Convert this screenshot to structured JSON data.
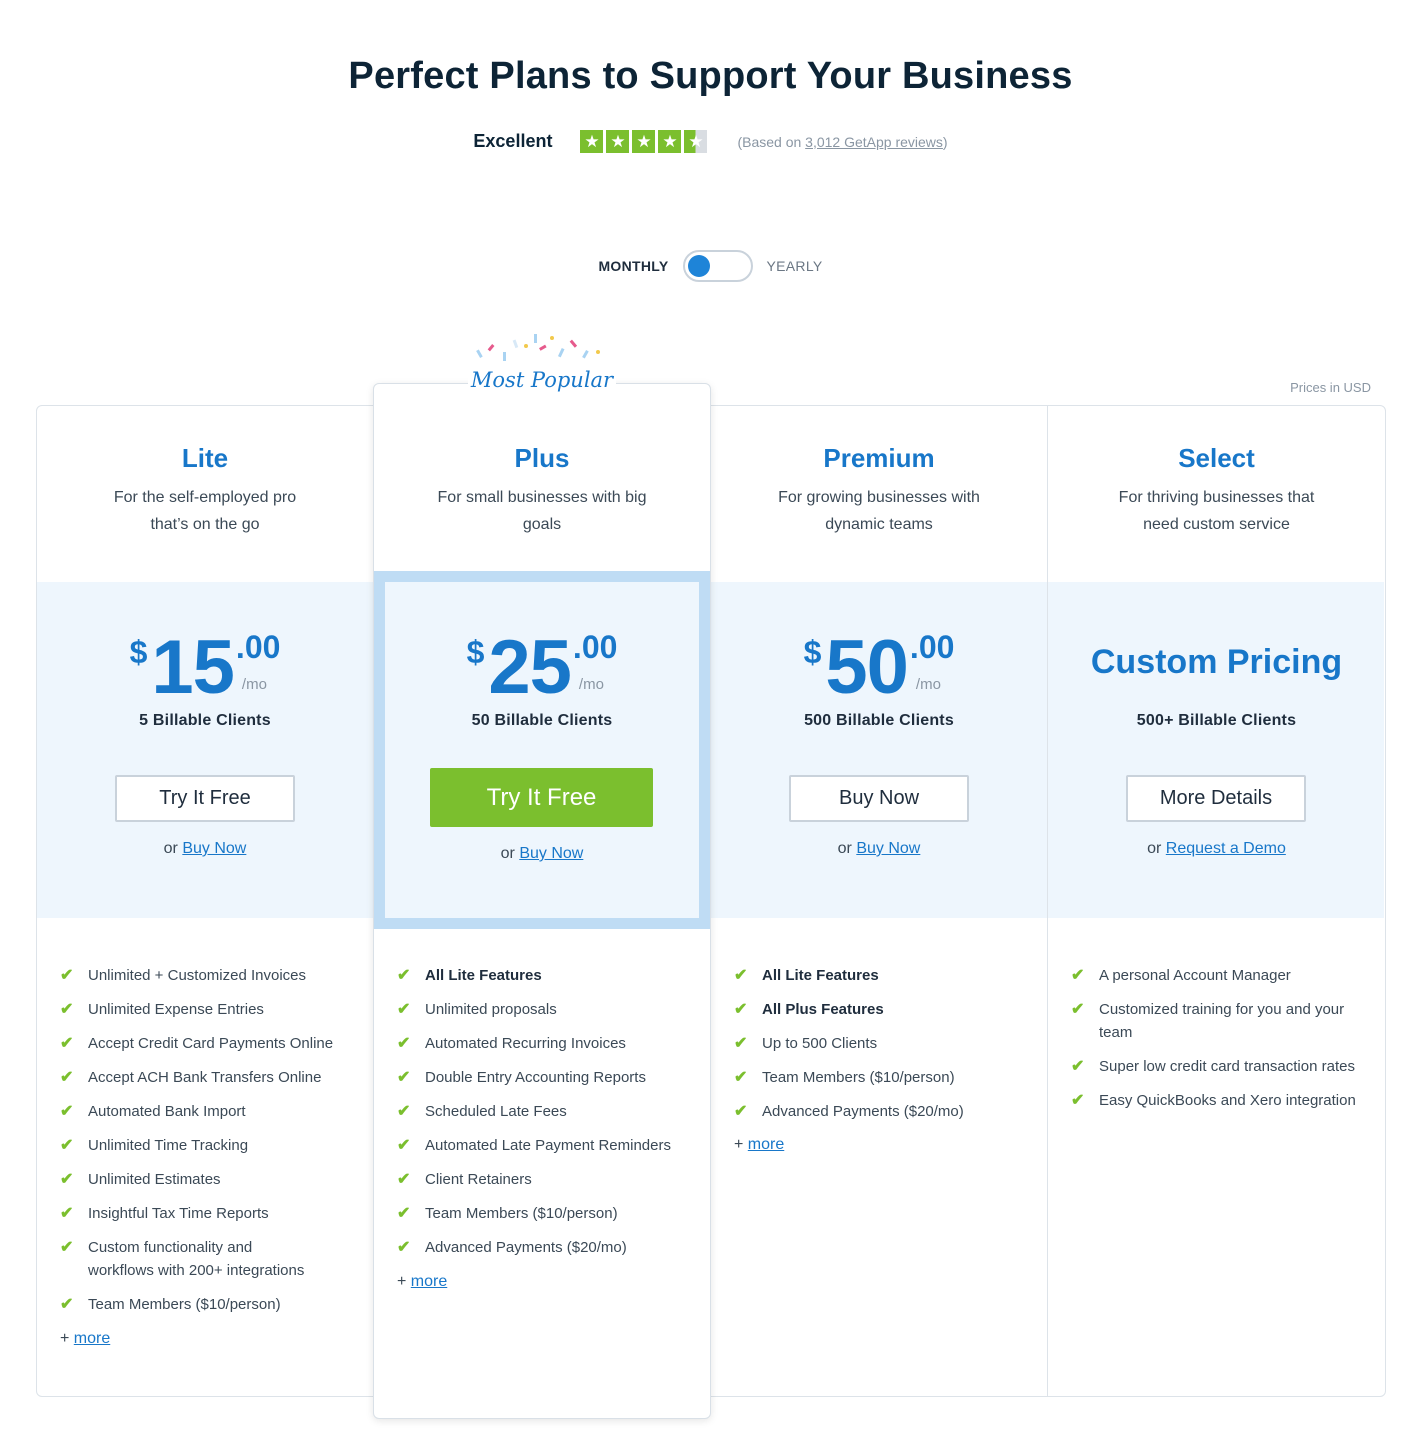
{
  "header": {
    "title": "Perfect Plans to Support Your Business",
    "rating_label": "Excellent",
    "stars": 4.5,
    "reviews_prefix": "(Based on ",
    "reviews_link": "3,012 GetApp reviews",
    "reviews_suffix": ")"
  },
  "billing_toggle": {
    "left_label": "MONTHLY",
    "right_label": "YEARLY",
    "selected": "MONTHLY"
  },
  "prices_note": "Prices in USD",
  "badge": "Most Popular",
  "colors": {
    "brand_blue": "#1877c9",
    "green": "#7bbf2e",
    "band": "#eef6fd"
  },
  "plans": [
    {
      "name": "Lite",
      "desc_line1": "For the self-employed pro",
      "desc_line2": "that’s on the go",
      "currency": "$",
      "amount": "15",
      "cents": ".00",
      "period": "/mo",
      "clients": "5 Billable Clients",
      "button": "Try It Free",
      "alt_prefix": "or ",
      "alt_link": "Buy Now",
      "features": [
        "Unlimited + Customized Invoices",
        "Unlimited Expense Entries",
        "Accept Credit Card Payments Online",
        "Accept ACH Bank Transfers Online",
        "Automated Bank Import",
        "Unlimited Time Tracking",
        "Unlimited Estimates",
        "Insightful Tax Time Reports",
        "Custom functionality and workflows with 200+ integrations",
        "Team Members ($10/person)"
      ],
      "more_prefix": "+ ",
      "more_link": "more"
    },
    {
      "name": "Plus",
      "desc_line1": "For small businesses with big",
      "desc_line2": "goals",
      "currency": "$",
      "amount": "25",
      "cents": ".00",
      "period": "/mo",
      "clients": "50 Billable Clients",
      "button": "Try It Free",
      "alt_prefix": "or ",
      "alt_link": "Buy Now",
      "features": [
        "All Lite Features",
        "Unlimited proposals",
        "Automated Recurring Invoices",
        "Double Entry Accounting Reports",
        "Scheduled Late Fees",
        "Automated Late Payment Reminders",
        "Client Retainers",
        "Team Members ($10/person)",
        "Advanced Payments ($20/mo)"
      ],
      "more_prefix": "+ ",
      "more_link": "more"
    },
    {
      "name": "Premium",
      "desc_line1": "For growing businesses with",
      "desc_line2": "dynamic teams",
      "currency": "$",
      "amount": "50",
      "cents": ".00",
      "period": "/mo",
      "clients": "500 Billable Clients",
      "button": "Buy Now",
      "alt_prefix": "or ",
      "alt_link": "Buy Now",
      "features": [
        "All Lite Features",
        "All Plus Features",
        "Up to 500 Clients",
        "Team Members ($10/person)",
        "Advanced Payments ($20/mo)"
      ],
      "more_prefix": "+ ",
      "more_link": "more"
    },
    {
      "name": "Select",
      "desc_line1": "For thriving businesses that",
      "desc_line2": "need custom service",
      "custom_price": "Custom Pricing",
      "clients": "500+ Billable Clients",
      "button": "More Details",
      "alt_prefix": "or ",
      "alt_link": "Request a Demo",
      "features": [
        "A personal Account Manager",
        "Customized training for you and your team",
        "Super low credit card transaction rates",
        "Easy QuickBooks and Xero integration"
      ]
    }
  ]
}
